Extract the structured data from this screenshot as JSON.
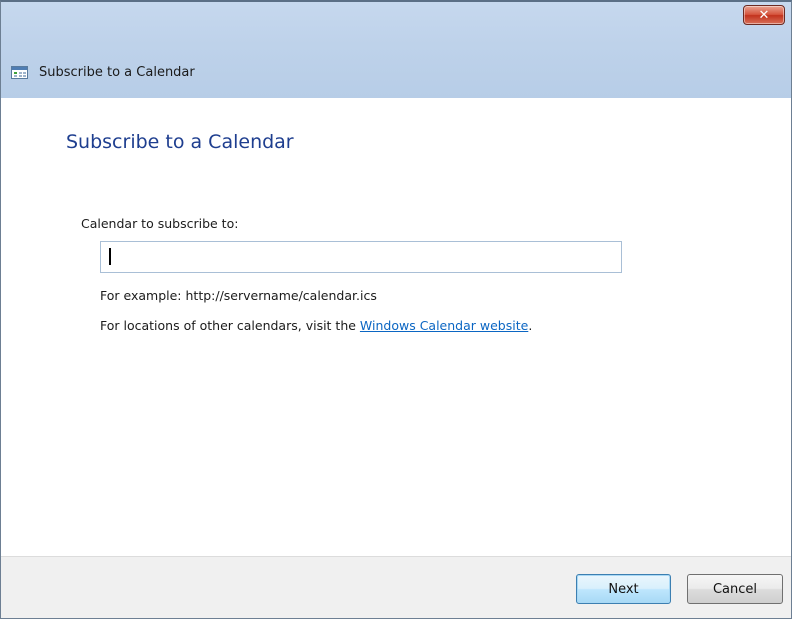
{
  "window": {
    "title": "Subscribe to a Calendar",
    "close_glyph": "✕"
  },
  "dialog": {
    "heading": "Subscribe to a Calendar",
    "field_label": "Calendar to subscribe to:",
    "input_value": "",
    "example_text": "For example: http://servername/calendar.ics",
    "locations_prefix": "For locations of other calendars, visit the ",
    "locations_link": "Windows Calendar website",
    "locations_suffix": "."
  },
  "buttons": {
    "next_label": "Next",
    "cancel_label": "Cancel"
  },
  "icons": {
    "title_icon": "calendar-icon",
    "close_icon": "close-icon"
  },
  "colors": {
    "heading": "#1e3e8f",
    "link": "#0b66c3",
    "close_button": "#c2321d",
    "titlebar": "#bed2ea"
  }
}
